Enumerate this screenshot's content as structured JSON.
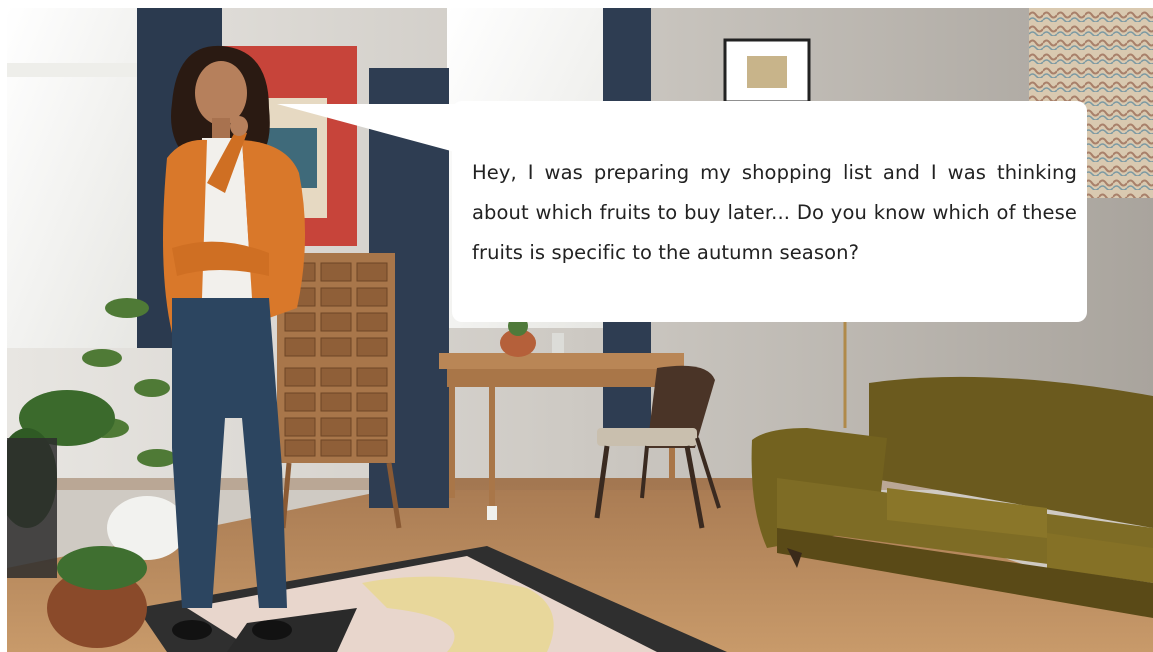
{
  "speech_bubble": {
    "text": "Hey, I was preparing my shopping list and I was thinking about which fruits to buy later... Do you know which of these fruits is specific to the autumn season?"
  },
  "scene": {
    "description_icon": "living-room-scene",
    "colors": {
      "wall": "#c9c4bd",
      "floor": "#b9875a",
      "curtain": "#2e3d52",
      "sofa": "#6b5a1e",
      "cardigan": "#d9782a",
      "jeans": "#2c4560"
    }
  }
}
